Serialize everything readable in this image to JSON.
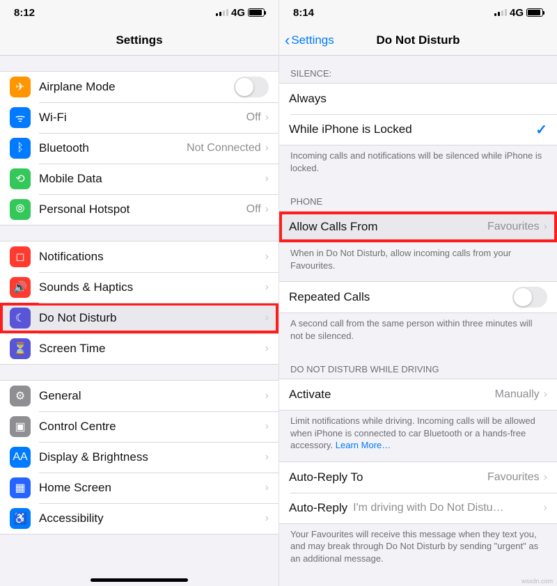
{
  "left": {
    "statusbar": {
      "time": "8:12",
      "network": "4G"
    },
    "title": "Settings",
    "group1": [
      {
        "icon": "airplane-icon",
        "bg": "#ff9500",
        "glyph": "✈",
        "label": "Airplane Mode",
        "toggle": true
      },
      {
        "icon": "wifi-icon",
        "bg": "#007aff",
        "glyph": "ᯤ",
        "label": "Wi-Fi",
        "value": "Off"
      },
      {
        "icon": "bluetooth-icon",
        "bg": "#007aff",
        "glyph": "ᛒ",
        "label": "Bluetooth",
        "value": "Not Connected"
      },
      {
        "icon": "mobile-data-icon",
        "bg": "#34c759",
        "glyph": "⟲",
        "label": "Mobile Data"
      },
      {
        "icon": "hotspot-icon",
        "bg": "#34c759",
        "glyph": "⦾",
        "label": "Personal Hotspot",
        "value": "Off"
      }
    ],
    "group2": [
      {
        "icon": "notifications-icon",
        "bg": "#ff3b30",
        "glyph": "◻",
        "label": "Notifications"
      },
      {
        "icon": "sounds-icon",
        "bg": "#ff3b30",
        "glyph": "🔊",
        "label": "Sounds & Haptics"
      },
      {
        "icon": "dnd-icon",
        "bg": "#5856d6",
        "glyph": "☾",
        "label": "Do Not Disturb",
        "highlight": true
      },
      {
        "icon": "screentime-icon",
        "bg": "#5856d6",
        "glyph": "⏳",
        "label": "Screen Time"
      }
    ],
    "group3": [
      {
        "icon": "general-icon",
        "bg": "#8e8e93",
        "glyph": "⚙",
        "label": "General"
      },
      {
        "icon": "controlcentre-icon",
        "bg": "#8e8e93",
        "glyph": "▣",
        "label": "Control Centre"
      },
      {
        "icon": "display-icon",
        "bg": "#007aff",
        "glyph": "AA",
        "label": "Display & Brightness"
      },
      {
        "icon": "homescreen-icon",
        "bg": "#2664ff",
        "glyph": "▦",
        "label": "Home Screen"
      },
      {
        "icon": "accessibility-icon",
        "bg": "#007aff",
        "glyph": "♿",
        "label": "Accessibility"
      }
    ]
  },
  "right": {
    "statusbar": {
      "time": "8:14",
      "network": "4G"
    },
    "back_label": "Settings",
    "title": "Do Not Disturb",
    "silence_header": "SILENCE:",
    "silence": [
      {
        "label": "Always"
      },
      {
        "label": "While iPhone is Locked",
        "checked": true
      }
    ],
    "silence_foot": "Incoming calls and notifications will be silenced while iPhone is locked.",
    "phone_header": "PHONE",
    "allow_label": "Allow Calls From",
    "allow_value": "Favourites",
    "phone_foot": "When in Do Not Disturb, allow incoming calls from your Favourites.",
    "repeated_label": "Repeated Calls",
    "repeated_foot": "A second call from the same person within three minutes will not be silenced.",
    "driving_header": "DO NOT DISTURB WHILE DRIVING",
    "activate_label": "Activate",
    "activate_value": "Manually",
    "driving_foot": "Limit notifications while driving. Incoming calls will be allowed when iPhone is connected to car Bluetooth or a hands-free accessory. ",
    "learn_more": "Learn More…",
    "autoreply_to_label": "Auto-Reply To",
    "autoreply_to_value": "Favourites",
    "autoreply_label": "Auto-Reply",
    "autoreply_value": "I'm driving with Do Not Distu…",
    "autoreply_foot": "Your Favourites will receive this message when they text you, and may break through Do Not Disturb by sending \"urgent\" as an additional message.",
    "watermark": "wsxdn.com"
  }
}
